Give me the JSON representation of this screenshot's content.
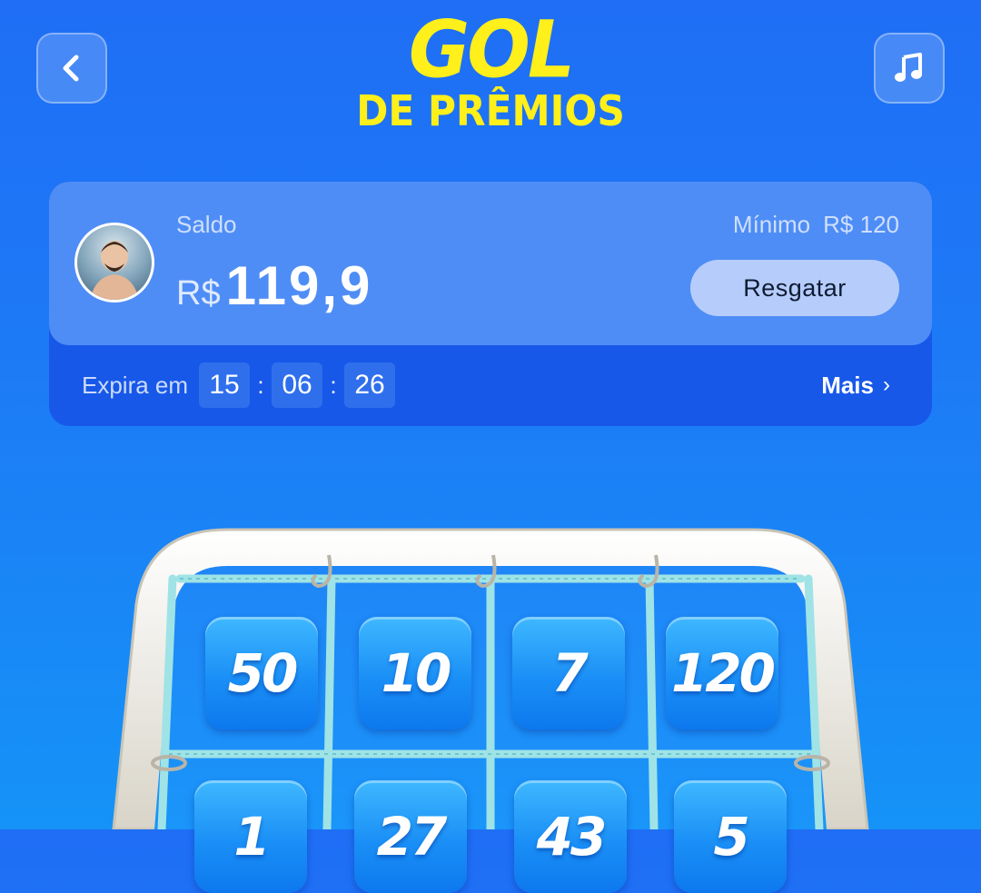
{
  "header": {
    "logo_line1": "GOL",
    "logo_line2": "DE PRÊMIOS",
    "back_icon": "chevron-left-icon",
    "music_icon": "music-note-icon"
  },
  "balance_card": {
    "saldo_label": "Saldo",
    "currency": "R$",
    "balance": "119,9",
    "minimo_label": "Mínimo",
    "minimo_value": "R$ 120",
    "redeem_label": "Resgatar",
    "expires_label": "Expira em",
    "expires_hours": "15",
    "expires_minutes": "06",
    "expires_seconds": "26",
    "time_separator": ":",
    "more_label": "Mais"
  },
  "prizes": {
    "row1": [
      "50",
      "10",
      "7",
      "120"
    ],
    "row2": [
      "1",
      "27",
      "43",
      "5"
    ]
  },
  "colors": {
    "background": "#1f6ef5",
    "logo_yellow": "#ffef1a",
    "card_top": "#4f8df6",
    "card_bottom": "#1758e9",
    "button": "#b6cdfb"
  }
}
